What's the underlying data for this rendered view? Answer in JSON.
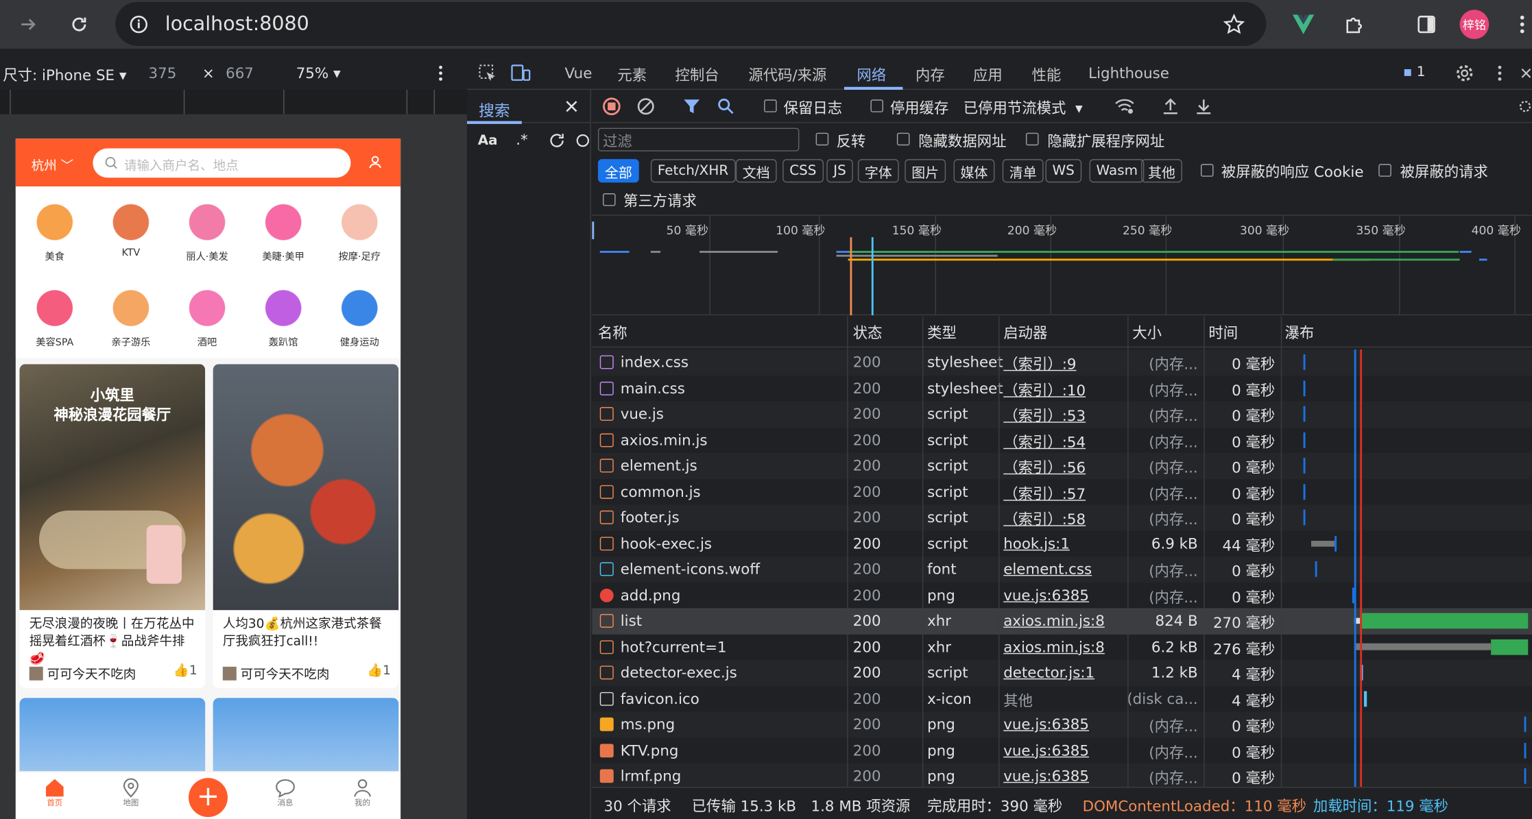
{
  "browser": {
    "url": "localhost:8080",
    "avatar": "梓铭"
  },
  "device": {
    "label": "尺寸: iPhone SE",
    "width": "375",
    "x": "×",
    "height": "667",
    "zoom": "75%"
  },
  "phone": {
    "city": "杭州",
    "search_placeholder": "请输入商户名、地点",
    "categories": [
      {
        "label": "美食",
        "color": "#f7a14a"
      },
      {
        "label": "KTV",
        "color": "#e8794d"
      },
      {
        "label": "丽人·美发",
        "color": "#f27ba7"
      },
      {
        "label": "美睫·美甲",
        "color": "#f86aa6"
      },
      {
        "label": "按摩·足疗",
        "color": "#f6c1b0"
      },
      {
        "label": "美容SPA",
        "color": "#f45d7e"
      },
      {
        "label": "亲子游乐",
        "color": "#f5a663"
      },
      {
        "label": "酒吧",
        "color": "#f577b4"
      },
      {
        "label": "轰趴馆",
        "color": "#c15fe3"
      },
      {
        "label": "健身运动",
        "color": "#3a86e6"
      }
    ],
    "cards": [
      {
        "image_title": "小筑里\n神秘浪漫花园餐厅",
        "title": "无尽浪漫的夜晚丨在万花丛中摇晃着红酒杯🍷品战斧牛排🥩",
        "user": "可可今天不吃肉",
        "likes": "1"
      },
      {
        "image_title": "",
        "title": "人均30💰杭州这家港式茶餐厅我疯狂打call!!",
        "user": "可可今天不吃肉",
        "likes": "1"
      }
    ],
    "tabs": [
      {
        "label": "首页",
        "active": true
      },
      {
        "label": "地图"
      },
      {
        "label": "+"
      },
      {
        "label": "消息"
      },
      {
        "label": "我的"
      }
    ]
  },
  "devtools": {
    "tabs": [
      "Vue",
      "元素",
      "控制台",
      "源代码/来源",
      "网络",
      "内存",
      "应用",
      "性能",
      "Lighthouse"
    ],
    "active_tab": "网络",
    "issues": "1",
    "search_tab": "搜索",
    "search_opts": [
      "Aa",
      ".*"
    ],
    "toolbar": {
      "preserve": "保留日志",
      "disable_cache": "停用缓存",
      "throttle": "已停用节流模式"
    },
    "filter": {
      "placeholder": "过滤",
      "invert": "反转",
      "hide_data": "隐藏数据网址",
      "hide_ext": "隐藏扩展程序网址"
    },
    "types": [
      "全部",
      "Fetch/XHR",
      "文档",
      "CSS",
      "JS",
      "字体",
      "图片",
      "媒体",
      "清单",
      "WS",
      "Wasm",
      "其他"
    ],
    "blocked_cookies": "被屏蔽的响应 Cookie",
    "blocked_requests": "被屏蔽的请求",
    "third_party": "第三方请求",
    "ticks": [
      "50 毫秒",
      "100 毫秒",
      "150 毫秒",
      "200 毫秒",
      "250 毫秒",
      "300 毫秒",
      "350 毫秒",
      "400 毫秒"
    ],
    "columns": [
      "名称",
      "状态",
      "类型",
      "启动器",
      "大小",
      "时间",
      "瀑布"
    ],
    "rows": [
      {
        "name": "index.css",
        "status": "200",
        "type": "stylesheet",
        "init": "（索引）:9",
        "size": "(内存...",
        "time": "0 毫秒",
        "icon": "css"
      },
      {
        "name": "main.css",
        "status": "200",
        "type": "stylesheet",
        "init": "（索引）:10",
        "size": "(内存...",
        "time": "0 毫秒",
        "icon": "css"
      },
      {
        "name": "vue.js",
        "status": "200",
        "type": "script",
        "init": "（索引）:53",
        "size": "(内存...",
        "time": "0 毫秒",
        "icon": "js"
      },
      {
        "name": "axios.min.js",
        "status": "200",
        "type": "script",
        "init": "（索引）:54",
        "size": "(内存...",
        "time": "0 毫秒",
        "icon": "js"
      },
      {
        "name": "element.js",
        "status": "200",
        "type": "script",
        "init": "（索引）:56",
        "size": "(内存...",
        "time": "0 毫秒",
        "icon": "js"
      },
      {
        "name": "common.js",
        "status": "200",
        "type": "script",
        "init": "（索引）:57",
        "size": "(内存...",
        "time": "0 毫秒",
        "icon": "js"
      },
      {
        "name": "footer.js",
        "status": "200",
        "type": "script",
        "init": "（索引）:58",
        "size": "(内存...",
        "time": "0 毫秒",
        "icon": "js"
      },
      {
        "name": "hook-exec.js",
        "status": "200",
        "type": "script",
        "init": "hook.js:1",
        "size": "6.9 kB",
        "time": "44 毫秒",
        "icon": "js"
      },
      {
        "name": "element-icons.woff",
        "status": "200",
        "type": "font",
        "init": "element.css",
        "size": "(内存...",
        "time": "0 毫秒",
        "icon": "font"
      },
      {
        "name": "add.png",
        "status": "200",
        "type": "png",
        "init": "vue.js:6385",
        "size": "(内存...",
        "time": "0 毫秒",
        "icon": "img"
      },
      {
        "name": "list",
        "status": "200",
        "type": "xhr",
        "init": "axios.min.js:8",
        "size": "824 B",
        "time": "270 毫秒",
        "icon": "xhr"
      },
      {
        "name": "hot?current=1",
        "status": "200",
        "type": "xhr",
        "init": "axios.min.js:8",
        "size": "6.2 kB",
        "time": "276 毫秒",
        "icon": "xhr"
      },
      {
        "name": "detector-exec.js",
        "status": "200",
        "type": "script",
        "init": "detector.js:1",
        "size": "1.2 kB",
        "time": "4 毫秒",
        "icon": "js"
      },
      {
        "name": "favicon.ico",
        "status": "200",
        "type": "x-icon",
        "init": "其他",
        "size": "(disk ca...",
        "time": "4 毫秒",
        "icon": "ico"
      },
      {
        "name": "ms.png",
        "status": "200",
        "type": "png",
        "init": "vue.js:6385",
        "size": "(内存...",
        "time": "0 毫秒",
        "icon": "img2"
      },
      {
        "name": "KTV.png",
        "status": "200",
        "type": "png",
        "init": "vue.js:6385",
        "size": "(内存...",
        "time": "0 毫秒",
        "icon": "img3"
      },
      {
        "name": "lrmf.png",
        "status": "200",
        "type": "png",
        "init": "vue.js:6385",
        "size": "(内存...",
        "time": "0 毫秒",
        "icon": "img3"
      }
    ],
    "status": {
      "requests": "30 个请求",
      "transferred": "已传输 15.3 kB",
      "resources": "1.8 MB 项资源",
      "finish": "完成用时：390 毫秒",
      "dcl": "DOMContentLoaded：110 毫秒",
      "load": "加载时间：119 毫秒"
    },
    "colors": {
      "dcl": "#f28b54",
      "load": "#4fc3f7",
      "accent": "#8ab4f8"
    }
  }
}
